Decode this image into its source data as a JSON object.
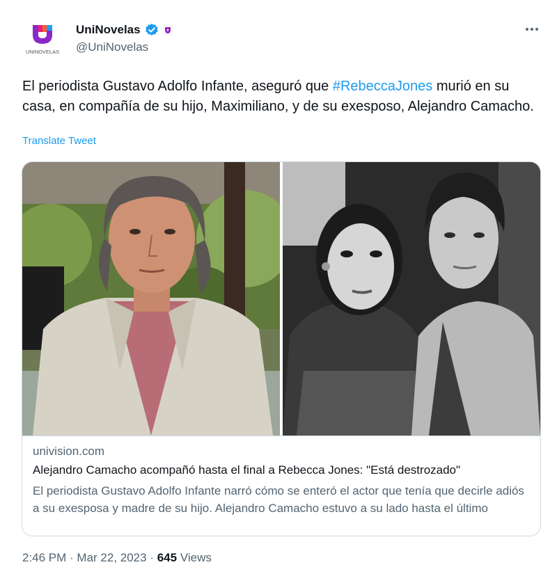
{
  "account": {
    "display_name": "UniNovelas",
    "handle": "@UniNovelas",
    "avatar_label": "UNINOVELAS"
  },
  "tweet": {
    "text_before": "El periodista Gustavo Adolfo Infante, aseguró que ",
    "hashtag": "#RebeccaJones",
    "text_after": " murió en su casa, en compañía de su hijo, Maximiliano, y de su exesposo, Alejandro Camacho.",
    "translate_label": "Translate Tweet"
  },
  "card": {
    "domain": "univision.com",
    "title": "Alejandro Camacho acompañó hasta el final a Rebecca Jones: \"Está destrozado\"",
    "description": "El periodista Gustavo Adolfo Infante narró cómo se enteró el actor que tenía que decirle adiós a su exesposa y madre de su hijo. Alejandro Camacho estuvo a su lado hasta el último momento."
  },
  "meta": {
    "time": "2:46 PM",
    "separator": " · ",
    "date": "Mar 22, 2023",
    "views_count": "645",
    "views_label": " Views"
  },
  "colors": {
    "accent": "#1d9bf0",
    "muted": "#536471",
    "text": "#0f1419",
    "border": "#cfd9de"
  },
  "icons": {
    "verified": "verified-badge-icon",
    "affiliate": "univision-affiliate-icon",
    "more": "more-options-icon"
  }
}
